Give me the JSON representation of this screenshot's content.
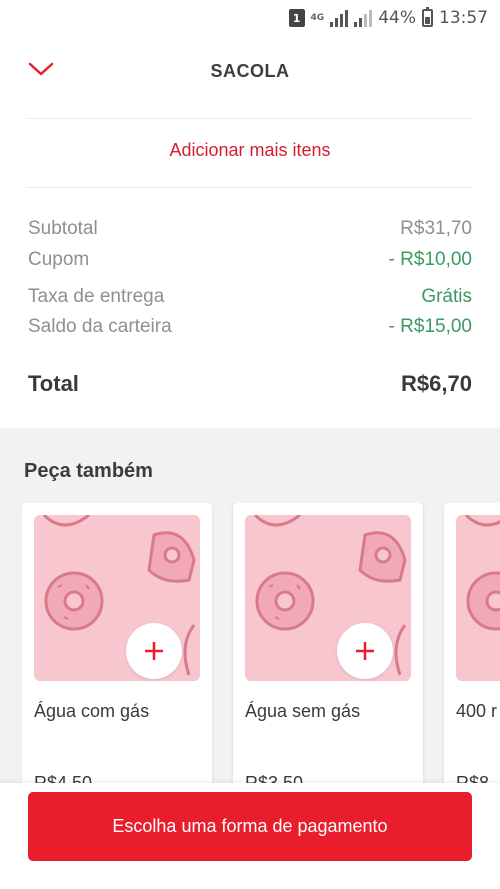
{
  "status_bar": {
    "sim": "1",
    "network": "4G",
    "battery": "44%",
    "time": "13:57"
  },
  "header": {
    "title": "SACOLA",
    "back_icon": "chevron-down-icon"
  },
  "add_more_label": "Adicionar mais itens",
  "summary": {
    "subtotal": {
      "label": "Subtotal",
      "value": "R$31,70"
    },
    "coupon": {
      "label": "Cupom",
      "value": "- R$10,00"
    },
    "delivery": {
      "label": "Taxa de entrega",
      "value": "Grátis"
    },
    "wallet": {
      "label": "Saldo da carteira",
      "value": "- R$15,00"
    },
    "total": {
      "label": "Total",
      "value": "R$6,70"
    }
  },
  "suggestions": {
    "title": "Peça também",
    "items": [
      {
        "name": "Água com gás",
        "price": "R$4,50"
      },
      {
        "name": "Água sem gás",
        "price": "R$3,50"
      },
      {
        "name": "400 r",
        "price": "R$8,"
      }
    ]
  },
  "payment_button": "Escolha uma forma de pagamento",
  "colors": {
    "brand_red": "#ea1d2c",
    "link_red": "#d51f30",
    "green": "#399b62",
    "card_pink": "#f7c6cf"
  }
}
